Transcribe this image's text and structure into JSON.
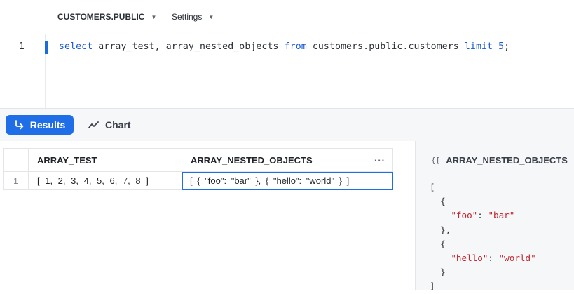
{
  "context": {
    "database": "CUSTOMERS.PUBLIC",
    "settings": "Settings"
  },
  "editor": {
    "line_number": "1",
    "tokens": [
      {
        "t": "select",
        "c": "kw"
      },
      {
        "t": " array_test, array_nested_objects ",
        "c": ""
      },
      {
        "t": "from",
        "c": "kw"
      },
      {
        "t": " customers.public.customers ",
        "c": ""
      },
      {
        "t": "limit",
        "c": "kw"
      },
      {
        "t": " ",
        "c": ""
      },
      {
        "t": "5",
        "c": "num"
      },
      {
        "t": ";",
        "c": ""
      }
    ]
  },
  "tabs": {
    "results_label": "Results",
    "chart_label": "Chart"
  },
  "grid": {
    "columns": [
      "ARRAY_TEST",
      "ARRAY_NESTED_OBJECTS"
    ],
    "more_label": "···",
    "rows": [
      {
        "num": "1",
        "array_test": "[ 1, 2, 3, 4, 5, 6, 7, 8 ]",
        "array_nested_objects": "[ {  \"foo\": \"bar\" }, {  \"hello\": \"world\" } ]"
      }
    ]
  },
  "details": {
    "type_icon": "{[",
    "column": "ARRAY_NESTED_OBJECTS",
    "json_lines": [
      [
        {
          "t": "[",
          "c": ""
        }
      ],
      [
        {
          "t": "  {",
          "c": ""
        }
      ],
      [
        {
          "t": "    ",
          "c": ""
        },
        {
          "t": "\"foo\"",
          "c": "s"
        },
        {
          "t": ": ",
          "c": ""
        },
        {
          "t": "\"bar\"",
          "c": "s"
        }
      ],
      [
        {
          "t": "  },",
          "c": ""
        }
      ],
      [
        {
          "t": "  {",
          "c": ""
        }
      ],
      [
        {
          "t": "    ",
          "c": ""
        },
        {
          "t": "\"hello\"",
          "c": "s"
        },
        {
          "t": ": ",
          "c": ""
        },
        {
          "t": "\"world\"",
          "c": "s"
        }
      ],
      [
        {
          "t": "  }",
          "c": ""
        }
      ],
      [
        {
          "t": "]",
          "c": ""
        }
      ]
    ]
  },
  "colors": {
    "accent": "#1f6ee8",
    "keyword": "#1a5bd1",
    "json_string": "#c0262d"
  },
  "icons": {
    "results": "return-arrow-icon",
    "chart": "line-chart-icon",
    "caret": "chevron-down-icon"
  }
}
